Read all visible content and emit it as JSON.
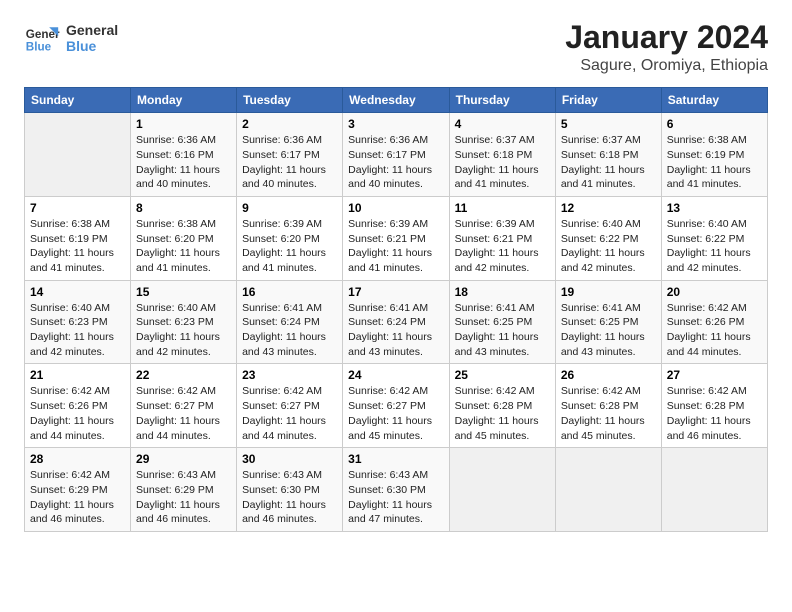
{
  "logo": {
    "line1": "General",
    "line2": "Blue"
  },
  "title": "January 2024",
  "subtitle": "Sagure, Oromiya, Ethiopia",
  "weekdays": [
    "Sunday",
    "Monday",
    "Tuesday",
    "Wednesday",
    "Thursday",
    "Friday",
    "Saturday"
  ],
  "weeks": [
    [
      {
        "day": "",
        "detail": ""
      },
      {
        "day": "1",
        "detail": "Sunrise: 6:36 AM\nSunset: 6:16 PM\nDaylight: 11 hours\nand 40 minutes."
      },
      {
        "day": "2",
        "detail": "Sunrise: 6:36 AM\nSunset: 6:17 PM\nDaylight: 11 hours\nand 40 minutes."
      },
      {
        "day": "3",
        "detail": "Sunrise: 6:36 AM\nSunset: 6:17 PM\nDaylight: 11 hours\nand 40 minutes."
      },
      {
        "day": "4",
        "detail": "Sunrise: 6:37 AM\nSunset: 6:18 PM\nDaylight: 11 hours\nand 41 minutes."
      },
      {
        "day": "5",
        "detail": "Sunrise: 6:37 AM\nSunset: 6:18 PM\nDaylight: 11 hours\nand 41 minutes."
      },
      {
        "day": "6",
        "detail": "Sunrise: 6:38 AM\nSunset: 6:19 PM\nDaylight: 11 hours\nand 41 minutes."
      }
    ],
    [
      {
        "day": "7",
        "detail": "Sunrise: 6:38 AM\nSunset: 6:19 PM\nDaylight: 11 hours\nand 41 minutes."
      },
      {
        "day": "8",
        "detail": "Sunrise: 6:38 AM\nSunset: 6:20 PM\nDaylight: 11 hours\nand 41 minutes."
      },
      {
        "day": "9",
        "detail": "Sunrise: 6:39 AM\nSunset: 6:20 PM\nDaylight: 11 hours\nand 41 minutes."
      },
      {
        "day": "10",
        "detail": "Sunrise: 6:39 AM\nSunset: 6:21 PM\nDaylight: 11 hours\nand 41 minutes."
      },
      {
        "day": "11",
        "detail": "Sunrise: 6:39 AM\nSunset: 6:21 PM\nDaylight: 11 hours\nand 42 minutes."
      },
      {
        "day": "12",
        "detail": "Sunrise: 6:40 AM\nSunset: 6:22 PM\nDaylight: 11 hours\nand 42 minutes."
      },
      {
        "day": "13",
        "detail": "Sunrise: 6:40 AM\nSunset: 6:22 PM\nDaylight: 11 hours\nand 42 minutes."
      }
    ],
    [
      {
        "day": "14",
        "detail": "Sunrise: 6:40 AM\nSunset: 6:23 PM\nDaylight: 11 hours\nand 42 minutes."
      },
      {
        "day": "15",
        "detail": "Sunrise: 6:40 AM\nSunset: 6:23 PM\nDaylight: 11 hours\nand 42 minutes."
      },
      {
        "day": "16",
        "detail": "Sunrise: 6:41 AM\nSunset: 6:24 PM\nDaylight: 11 hours\nand 43 minutes."
      },
      {
        "day": "17",
        "detail": "Sunrise: 6:41 AM\nSunset: 6:24 PM\nDaylight: 11 hours\nand 43 minutes."
      },
      {
        "day": "18",
        "detail": "Sunrise: 6:41 AM\nSunset: 6:25 PM\nDaylight: 11 hours\nand 43 minutes."
      },
      {
        "day": "19",
        "detail": "Sunrise: 6:41 AM\nSunset: 6:25 PM\nDaylight: 11 hours\nand 43 minutes."
      },
      {
        "day": "20",
        "detail": "Sunrise: 6:42 AM\nSunset: 6:26 PM\nDaylight: 11 hours\nand 44 minutes."
      }
    ],
    [
      {
        "day": "21",
        "detail": "Sunrise: 6:42 AM\nSunset: 6:26 PM\nDaylight: 11 hours\nand 44 minutes."
      },
      {
        "day": "22",
        "detail": "Sunrise: 6:42 AM\nSunset: 6:27 PM\nDaylight: 11 hours\nand 44 minutes."
      },
      {
        "day": "23",
        "detail": "Sunrise: 6:42 AM\nSunset: 6:27 PM\nDaylight: 11 hours\nand 44 minutes."
      },
      {
        "day": "24",
        "detail": "Sunrise: 6:42 AM\nSunset: 6:27 PM\nDaylight: 11 hours\nand 45 minutes."
      },
      {
        "day": "25",
        "detail": "Sunrise: 6:42 AM\nSunset: 6:28 PM\nDaylight: 11 hours\nand 45 minutes."
      },
      {
        "day": "26",
        "detail": "Sunrise: 6:42 AM\nSunset: 6:28 PM\nDaylight: 11 hours\nand 45 minutes."
      },
      {
        "day": "27",
        "detail": "Sunrise: 6:42 AM\nSunset: 6:28 PM\nDaylight: 11 hours\nand 46 minutes."
      }
    ],
    [
      {
        "day": "28",
        "detail": "Sunrise: 6:42 AM\nSunset: 6:29 PM\nDaylight: 11 hours\nand 46 minutes."
      },
      {
        "day": "29",
        "detail": "Sunrise: 6:43 AM\nSunset: 6:29 PM\nDaylight: 11 hours\nand 46 minutes."
      },
      {
        "day": "30",
        "detail": "Sunrise: 6:43 AM\nSunset: 6:30 PM\nDaylight: 11 hours\nand 46 minutes."
      },
      {
        "day": "31",
        "detail": "Sunrise: 6:43 AM\nSunset: 6:30 PM\nDaylight: 11 hours\nand 47 minutes."
      },
      {
        "day": "",
        "detail": ""
      },
      {
        "day": "",
        "detail": ""
      },
      {
        "day": "",
        "detail": ""
      }
    ]
  ]
}
